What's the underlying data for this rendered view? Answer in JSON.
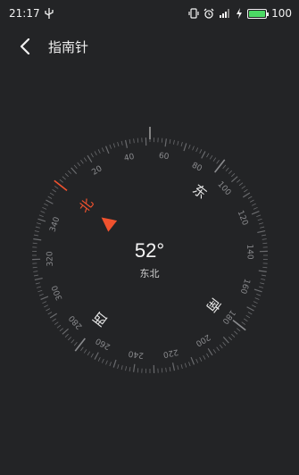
{
  "status_bar": {
    "time": "21:17",
    "usb_icon": "usb-icon",
    "battery_percent": "100",
    "battery_level": 1.0,
    "icons": [
      "vibrate-icon",
      "alarm-icon",
      "signal-icon",
      "charging-icon"
    ]
  },
  "header": {
    "back_icon": "chevron-left-icon",
    "title": "指南针"
  },
  "compass": {
    "heading": "52°",
    "direction": "东北",
    "needle_color": "#f0522e",
    "north_label": "北",
    "east_label": "东",
    "south_label": "南",
    "west_label": "西",
    "degree_labels": [
      "20",
      "40",
      "60",
      "80",
      "100",
      "120",
      "140",
      "160",
      "180",
      "200",
      "220",
      "240",
      "260",
      "280",
      "300",
      "320",
      "340"
    ],
    "north_label_color": "#f0522e"
  }
}
